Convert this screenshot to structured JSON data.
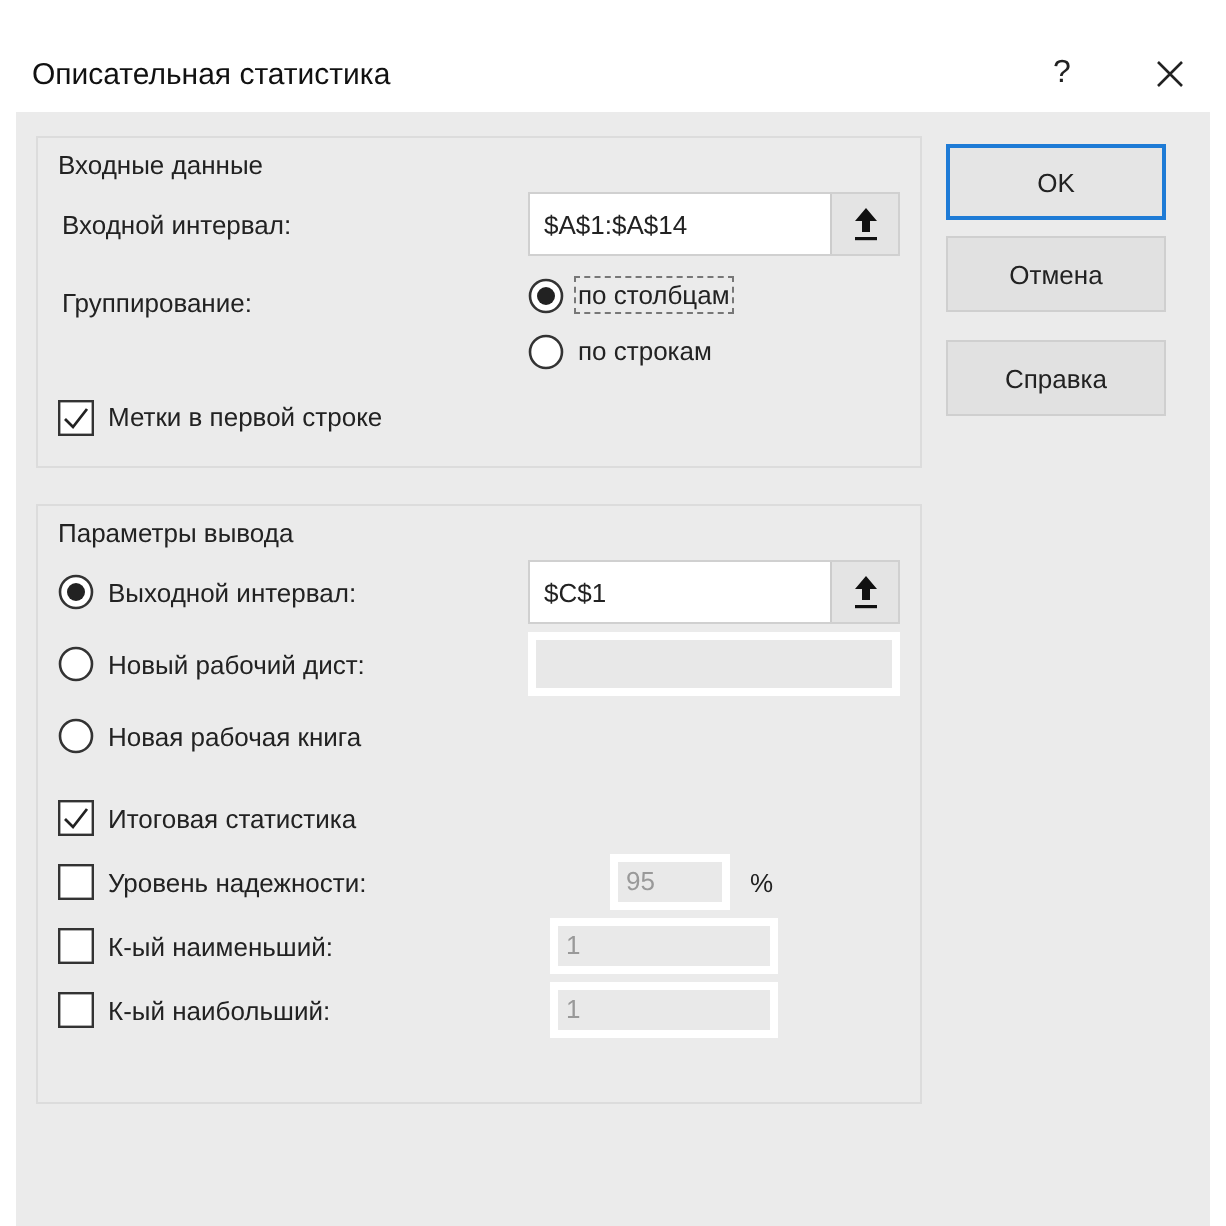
{
  "window": {
    "title": "Описательная статистика",
    "help": "?"
  },
  "input_group": {
    "title": "Входные данные",
    "input_range": {
      "label": "Входной интервал:",
      "value": "$A$1:$A$14"
    },
    "grouping": {
      "label": "Группирование:",
      "options": [
        {
          "label": "по столбцам",
          "selected": true,
          "focused": true
        },
        {
          "label": "по строкам",
          "selected": false,
          "focused": false
        }
      ]
    },
    "labels_checkbox": {
      "label": "Метки в первой строке",
      "checked": true
    }
  },
  "output_group": {
    "title": "Параметры вывода",
    "destinations": [
      {
        "kind": "range",
        "label": "Выходной интервал:",
        "selected": true,
        "value": "$C$1"
      },
      {
        "kind": "field",
        "label": "Новый рабочий дист:",
        "selected": false
      },
      {
        "kind": "none",
        "label": "Новая рабочая книга",
        "selected": false
      }
    ],
    "options": [
      {
        "kind": "plain",
        "label": "Итоговая статистика",
        "checked": true
      },
      {
        "kind": "percent",
        "label": "Уровень надежности:",
        "checked": false,
        "value": "95",
        "unit": "%",
        "disabled": true
      },
      {
        "kind": "number",
        "label": "К-ый наименьший:",
        "checked": false,
        "value": "1",
        "disabled": true
      },
      {
        "kind": "number",
        "label": "К-ый наибольший:",
        "checked": false,
        "value": "1",
        "disabled": true
      }
    ]
  },
  "buttons": [
    {
      "label": "OK",
      "default": true
    },
    {
      "label": "Отмена",
      "default": false
    },
    {
      "label": "Справка",
      "default": false
    }
  ]
}
